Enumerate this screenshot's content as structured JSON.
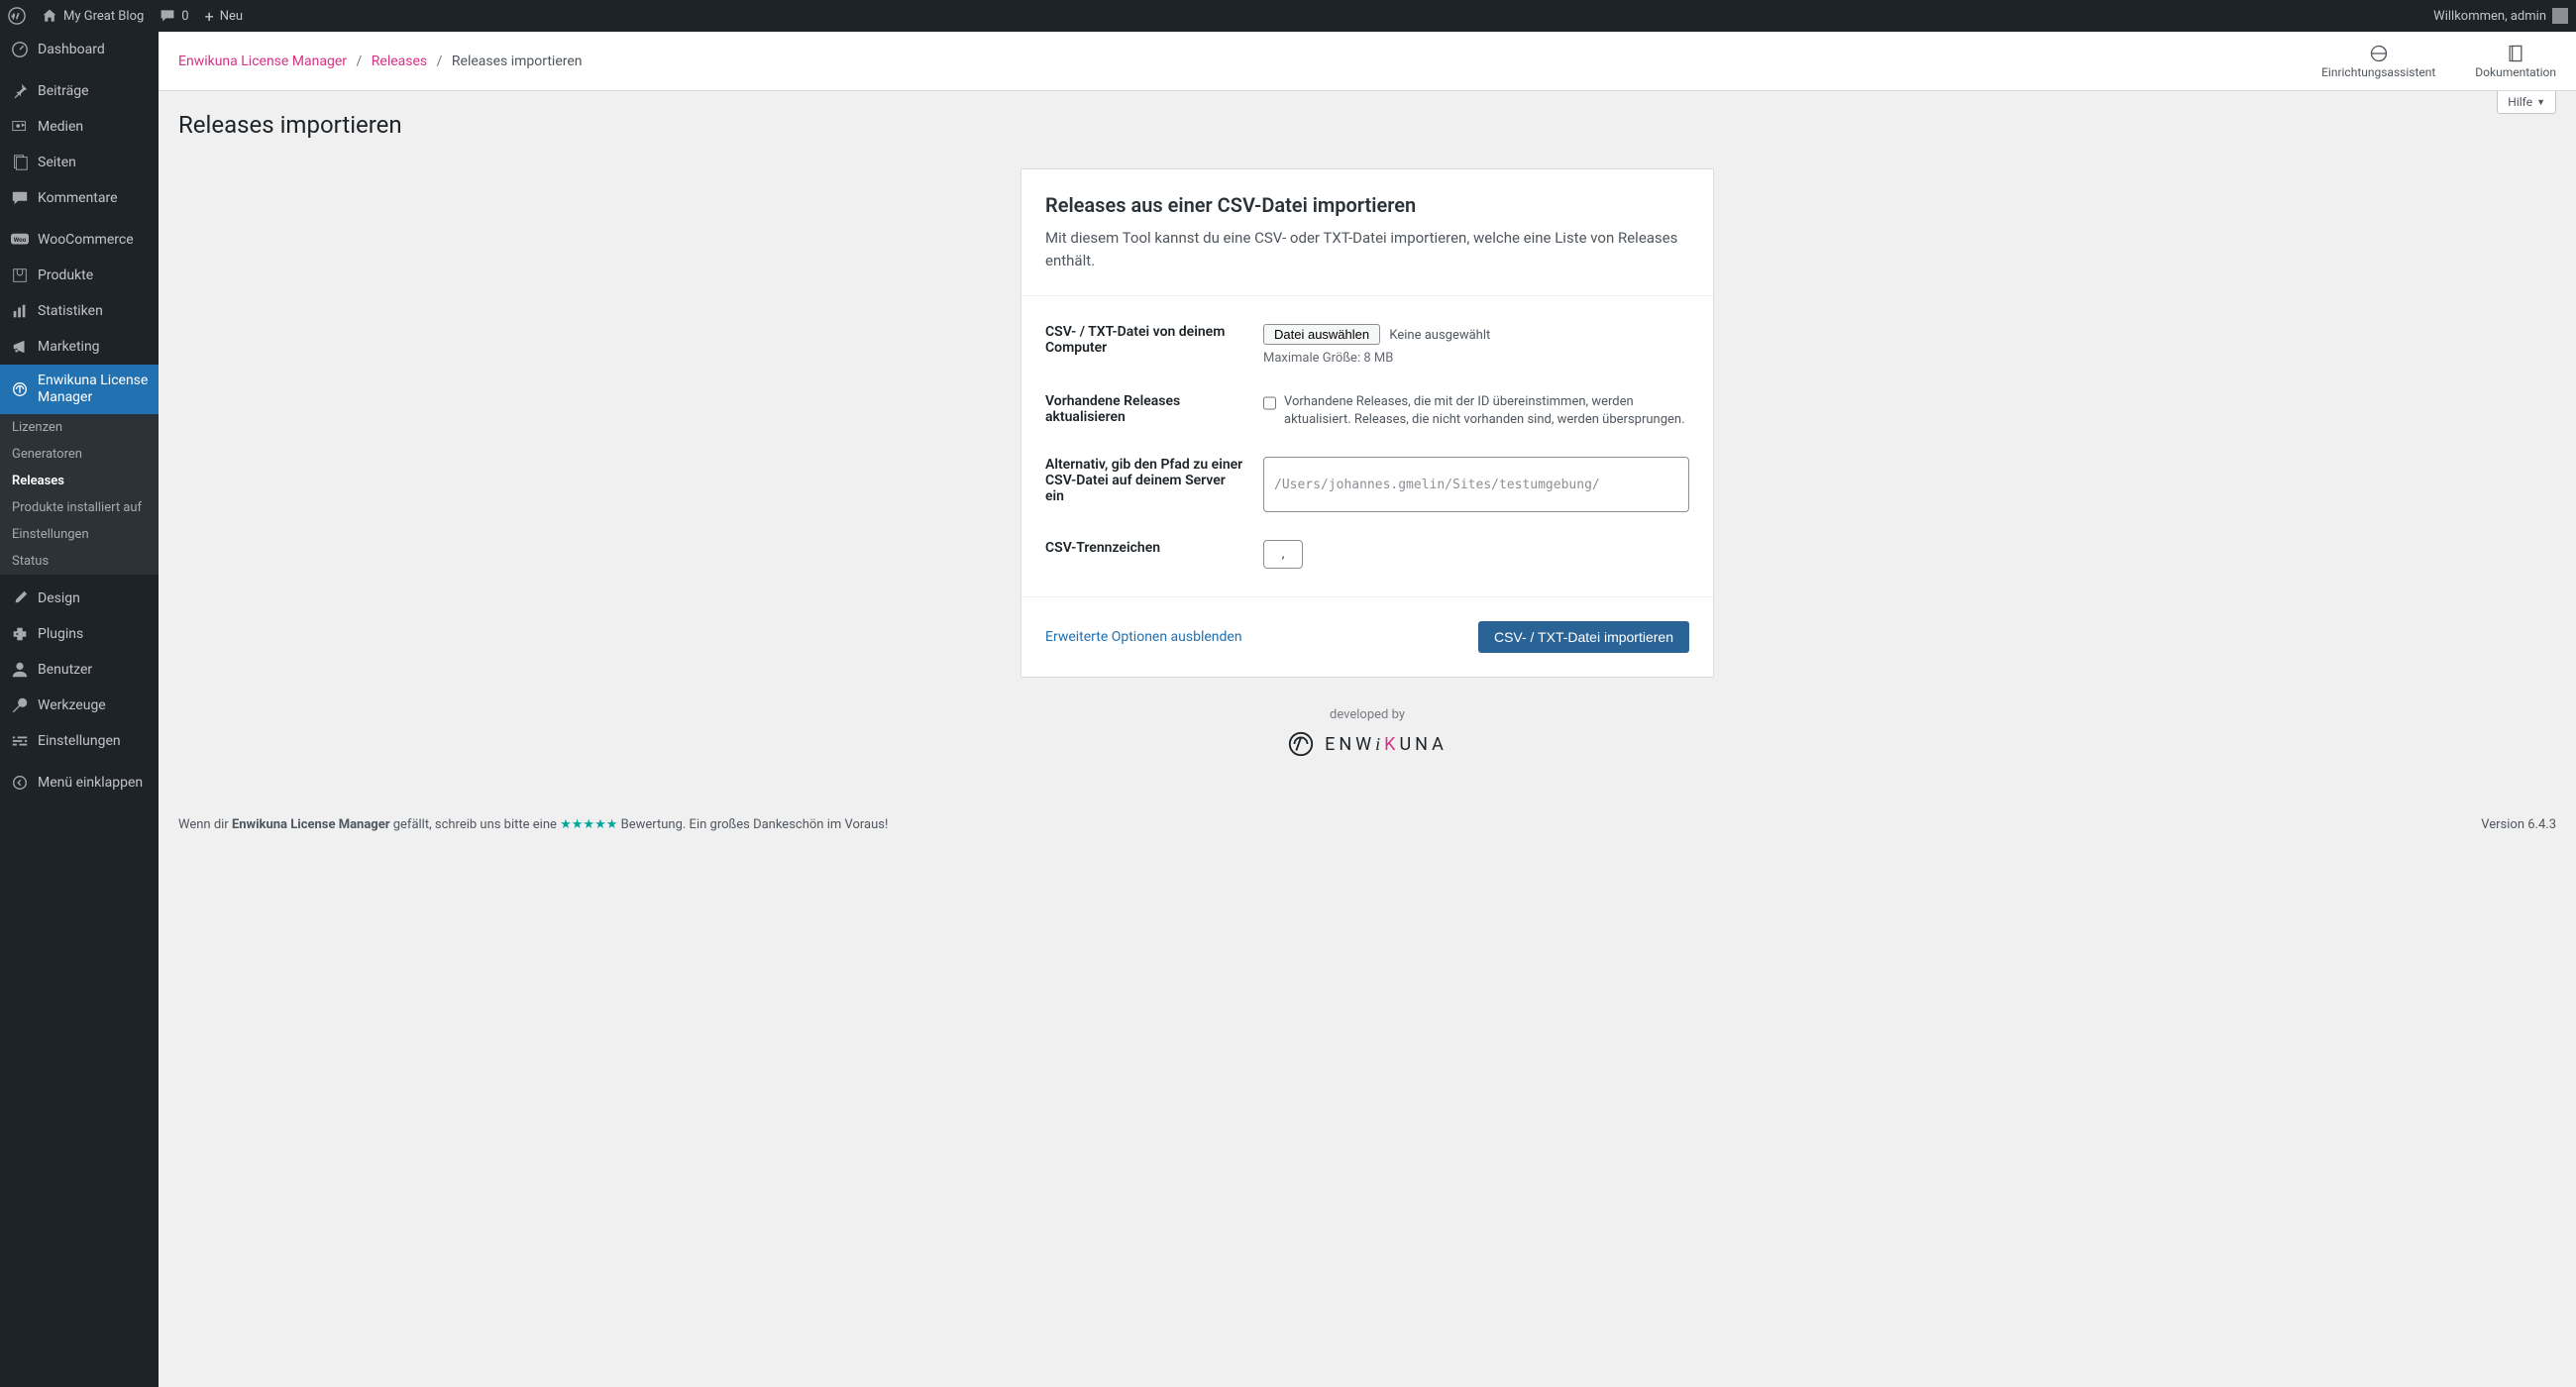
{
  "adminbar": {
    "site_name": "My Great Blog",
    "comments": "0",
    "new_label": "Neu",
    "welcome": "Willkommen, admin"
  },
  "sidebar": {
    "items": [
      {
        "label": "Dashboard",
        "icon": "dashboard"
      },
      {
        "label": "Beiträge",
        "icon": "pin"
      },
      {
        "label": "Medien",
        "icon": "media"
      },
      {
        "label": "Seiten",
        "icon": "page"
      },
      {
        "label": "Kommentare",
        "icon": "comment"
      },
      {
        "label": "WooCommerce",
        "icon": "woo"
      },
      {
        "label": "Produkte",
        "icon": "product"
      },
      {
        "label": "Statistiken",
        "icon": "stats"
      },
      {
        "label": "Marketing",
        "icon": "marketing"
      },
      {
        "label": "Enwikuna License Manager",
        "icon": "elm",
        "active": true
      },
      {
        "label": "Design",
        "icon": "brush"
      },
      {
        "label": "Plugins",
        "icon": "plugin"
      },
      {
        "label": "Benutzer",
        "icon": "user"
      },
      {
        "label": "Werkzeuge",
        "icon": "tools"
      },
      {
        "label": "Einstellungen",
        "icon": "settings"
      },
      {
        "label": "Menü einklappen",
        "icon": "collapse"
      }
    ],
    "submenu": [
      {
        "label": "Lizenzen"
      },
      {
        "label": "Generatoren"
      },
      {
        "label": "Releases",
        "active": true
      },
      {
        "label": "Produkte installiert auf"
      },
      {
        "label": "Einstellungen"
      },
      {
        "label": "Status"
      }
    ]
  },
  "topbar": {
    "crumb1": "Enwikuna License Manager",
    "crumb2": "Releases",
    "crumb3": "Releases importieren",
    "link1": "Einrichtungsassistent",
    "link2": "Dokumentation",
    "help": "Hilfe"
  },
  "page": {
    "title": "Releases importieren",
    "card_title": "Releases aus einer CSV-Datei importieren",
    "card_desc": "Mit diesem Tool kannst du eine CSV- oder TXT-Datei importieren, welche eine Liste von Releases enthält.",
    "row1_label": "CSV- / TXT-Datei von deinem Computer",
    "file_btn": "Datei auswählen",
    "file_status": "Keine ausgewählt",
    "file_help": "Maximale Größe: 8 MB",
    "row2_label": "Vorhandene Releases aktualisieren",
    "row2_desc": "Vorhandene Releases, die mit der ID übereinstimmen, werden aktualisiert. Releases, die nicht vorhanden sind, werden übersprungen.",
    "row3_label": "Alternativ, gib den Pfad zu einer CSV-Datei auf deinem Server ein",
    "row3_placeholder": "/Users/johannes.gmelin/Sites/testumgebung/",
    "row4_label": "CSV-Trennzeichen",
    "row4_value": ",",
    "toggle_link": "Erweiterte Optionen ausblenden",
    "submit": "CSV- / TXT-Datei importieren",
    "credit": "developed by",
    "credit_brand_1": "ENW",
    "credit_brand_k": "K",
    "credit_brand_2": "UNA"
  },
  "footer": {
    "text1": "Wenn dir ",
    "text2": "Enwikuna License Manager",
    "text3": " gefällt, schreib uns bitte eine ",
    "stars": "★★★★★",
    "text4": " Bewertung. Ein großes Dankeschön im Voraus!",
    "version": "Version 6.4.3"
  }
}
